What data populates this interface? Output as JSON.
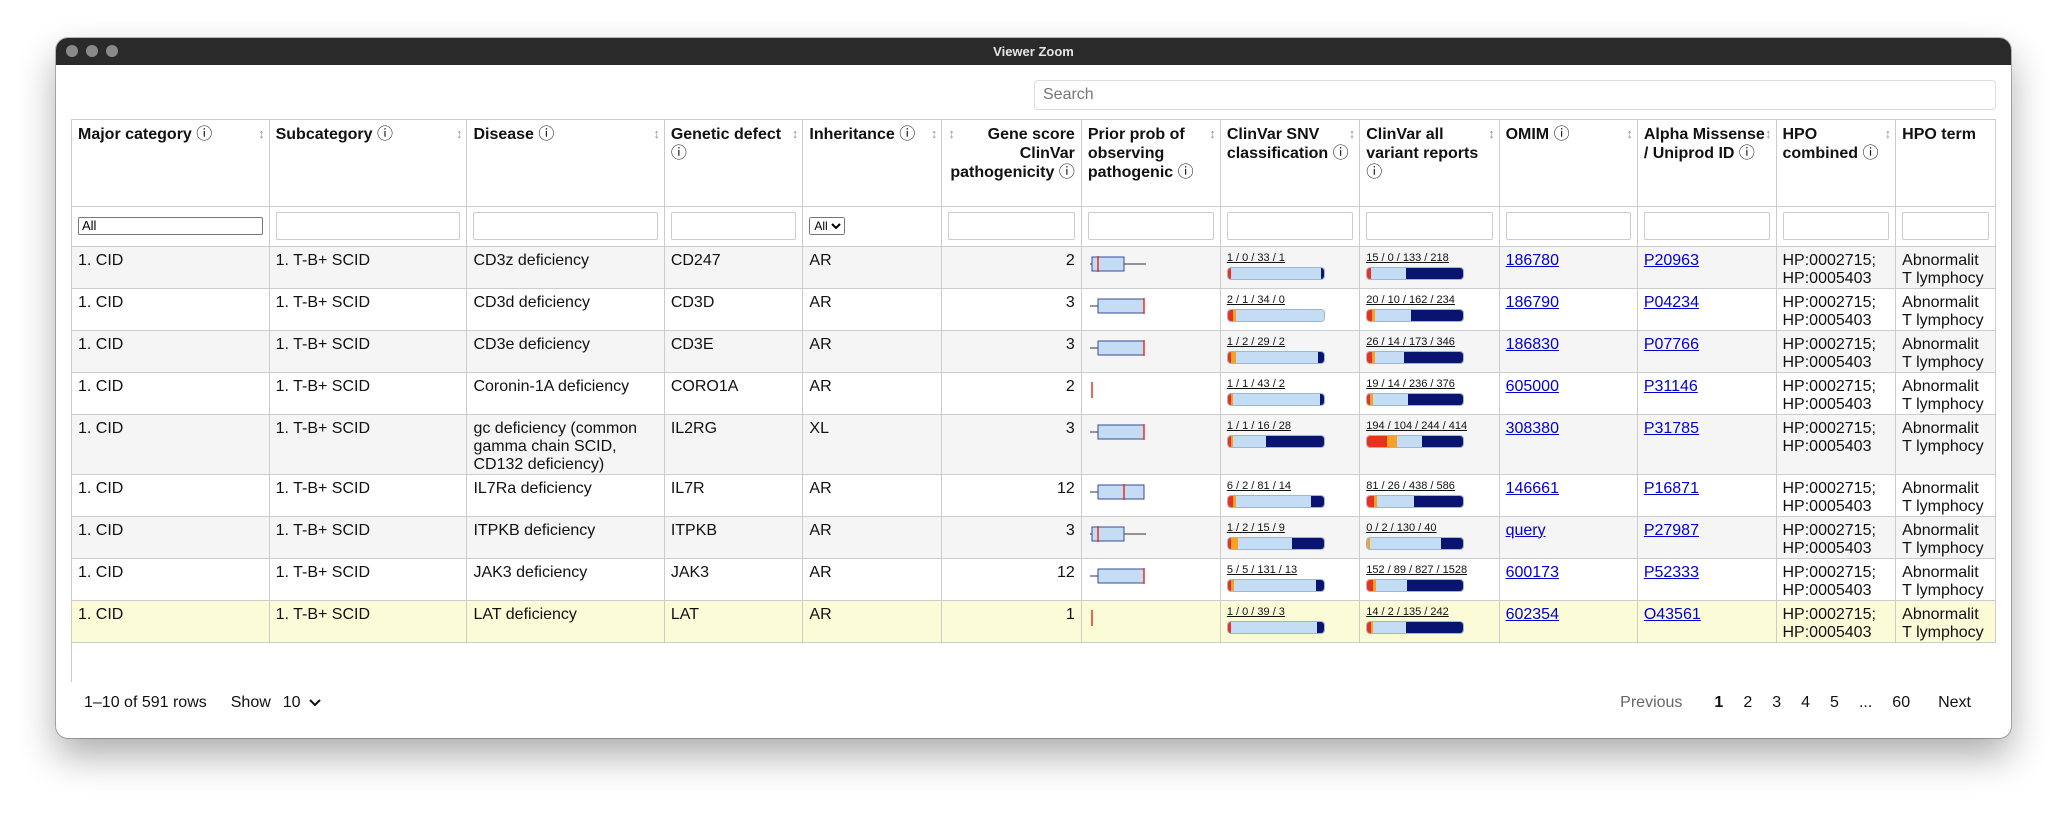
{
  "window": {
    "title": "Viewer Zoom"
  },
  "search": {
    "placeholder": "Search"
  },
  "columns": [
    {
      "label": "Major category",
      "info": true
    },
    {
      "label": "Subcategory",
      "info": true
    },
    {
      "label": "Disease",
      "info": true
    },
    {
      "label": "Genetic defect",
      "info": true
    },
    {
      "label": "Inheritance",
      "info": true
    },
    {
      "label": "Gene score ClinVar pathogenicity",
      "info": true
    },
    {
      "label": "Prior prob of observing pathogenic",
      "info": true
    },
    {
      "label": "ClinVar SNV classification",
      "info": true
    },
    {
      "label": "ClinVar all variant reports",
      "info": true
    },
    {
      "label": "OMIM",
      "info": true
    },
    {
      "label": "Alpha Missense / Uniprod ID",
      "info": true
    },
    {
      "label": "HPO combined",
      "info": true
    },
    {
      "label": "HPO term",
      "info": false
    }
  ],
  "filters": {
    "major_select": "All",
    "inheritance_select": "All"
  },
  "info_glyph": "ⓘ",
  "sort_glyph": "↕",
  "rows": [
    {
      "major": "1. CID",
      "sub": "1. T-B+ SCID",
      "disease": "CD3z deficiency",
      "gene": "CD247",
      "inh": "AR",
      "score": "2",
      "snv": "1 / 0 / 33 / 1",
      "all": "15 / 0 / 133 / 218",
      "omim": "186780",
      "uniprot": "P20963",
      "hpo": "HP:0002715; HP:0005403",
      "term": "Abnormalit T lymphocy"
    },
    {
      "major": "1. CID",
      "sub": "1. T-B+ SCID",
      "disease": "CD3d deficiency",
      "gene": "CD3D",
      "inh": "AR",
      "score": "3",
      "snv": "2 / 1 / 34 / 0",
      "all": "20 / 10 / 162 / 234",
      "omim": "186790",
      "uniprot": "P04234",
      "hpo": "HP:0002715; HP:0005403",
      "term": "Abnormalit T lymphocy"
    },
    {
      "major": "1. CID",
      "sub": "1. T-B+ SCID",
      "disease": "CD3e deficiency",
      "gene": "CD3E",
      "inh": "AR",
      "score": "3",
      "snv": "1 / 2 / 29 / 2",
      "all": "26 / 14 / 173 / 346",
      "omim": "186830",
      "uniprot": "P07766",
      "hpo": "HP:0002715; HP:0005403",
      "term": "Abnormalit T lymphocy"
    },
    {
      "major": "1. CID",
      "sub": "1. T-B+ SCID",
      "disease": "Coronin-1A deficiency",
      "gene": "CORO1A",
      "inh": "AR",
      "score": "2",
      "snv": "1 / 1 / 43 / 2",
      "all": "19 / 14 / 236 / 376",
      "omim": "605000",
      "uniprot": "P31146",
      "hpo": "HP:0002715; HP:0005403",
      "term": "Abnormalit T lymphocy"
    },
    {
      "major": "1. CID",
      "sub": "1. T-B+ SCID",
      "disease": "gc deficiency (common gamma chain SCID, CD132 deficiency)",
      "gene": "IL2RG",
      "inh": "XL",
      "score": "3",
      "snv": "1 / 1 / 16 / 28",
      "all": "194 / 104 / 244 / 414",
      "omim": "308380",
      "uniprot": "P31785",
      "hpo": "HP:0002715; HP:0005403",
      "term": "Abnormalit T lymphocy"
    },
    {
      "major": "1. CID",
      "sub": "1. T-B+ SCID",
      "disease": "IL7Ra deficiency",
      "gene": "IL7R",
      "inh": "AR",
      "score": "12",
      "snv": "6 / 2 / 81 / 14",
      "all": "81 / 26 / 438 / 586",
      "omim": "146661",
      "uniprot": "P16871",
      "hpo": "HP:0002715; HP:0005403",
      "term": "Abnormalit T lymphocy"
    },
    {
      "major": "1. CID",
      "sub": "1. T-B+ SCID",
      "disease": "ITPKB deficiency",
      "gene": "ITPKB",
      "inh": "AR",
      "score": "3",
      "snv": "1 / 2 / 15 / 9",
      "all": "0 / 2 / 130 / 40",
      "omim": "query",
      "uniprot": "P27987",
      "hpo": "HP:0002715; HP:0005403",
      "term": "Abnormalit T lymphocy"
    },
    {
      "major": "1. CID",
      "sub": "1. T-B+ SCID",
      "disease": "JAK3 deficiency",
      "gene": "JAK3",
      "inh": "AR",
      "score": "12",
      "snv": "5 / 5 / 131 / 13",
      "all": "152 / 89 / 827 / 1528",
      "omim": "600173",
      "uniprot": "P52333",
      "hpo": "HP:0002715; HP:0005403",
      "term": "Abnormalit T lymphocy"
    },
    {
      "major": "1. CID",
      "sub": "1. T-B+ SCID",
      "disease": "LAT deficiency",
      "gene": "LAT",
      "inh": "AR",
      "score": "1",
      "snv": "1 / 0 / 39 / 3",
      "all": "14 / 2 / 135 / 242",
      "omim": "602354",
      "uniprot": "O43561",
      "hpo": "HP:0002715; HP:0005403",
      "term": "Abnormalit T lymphocy"
    }
  ],
  "footer": {
    "rows_info": "1–10 of 591 rows",
    "show_label": "Show",
    "show_value": "10",
    "prev": "Previous",
    "pages": [
      "1",
      "2",
      "3",
      "4",
      "5",
      "...",
      "60"
    ],
    "next": "Next"
  },
  "colors": {
    "red": "#e8321f",
    "orange": "#f5a12a",
    "lightblue": "#c4dcf4",
    "navy": "#0a1470",
    "link": "#0000cc",
    "highlight": "#fcfbd8"
  }
}
